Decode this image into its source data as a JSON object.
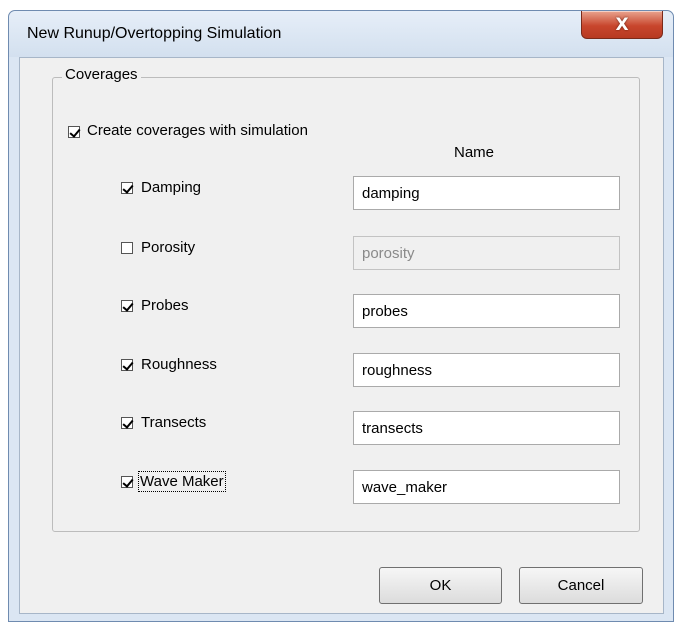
{
  "window": {
    "title": "New Runup/Overtopping Simulation",
    "close_glyph": "X"
  },
  "group": {
    "label": "Coverages",
    "create_checkbox": {
      "label": "Create coverages with simulation",
      "checked": true
    },
    "name_header": "Name",
    "rows": [
      {
        "label": "Damping",
        "checked": true,
        "value": "damping",
        "enabled": true
      },
      {
        "label": "Porosity",
        "checked": false,
        "value": "porosity",
        "enabled": false
      },
      {
        "label": "Probes",
        "checked": true,
        "value": "probes",
        "enabled": true
      },
      {
        "label": "Roughness",
        "checked": true,
        "value": "roughness",
        "enabled": true
      },
      {
        "label": "Transects",
        "checked": true,
        "value": "transects",
        "enabled": true
      },
      {
        "label": "Wave Maker",
        "checked": true,
        "value": "wave_maker",
        "enabled": true
      }
    ]
  },
  "buttons": {
    "ok": "OK",
    "cancel": "Cancel"
  },
  "colors": {
    "close_button": "#c8462d",
    "window_frame": "#dbe6f3",
    "client_bg": "#f0f0f0"
  }
}
